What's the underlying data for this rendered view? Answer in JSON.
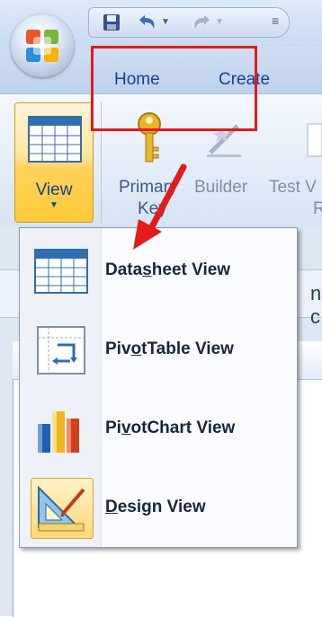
{
  "tabs": [
    {
      "label": "Home"
    },
    {
      "label": "Create"
    }
  ],
  "ribbon": {
    "view_label": "View",
    "primary_key": {
      "line1": "Primary",
      "line2": "Key"
    },
    "builder": "Builder",
    "test": {
      "line1": "Test V",
      "line2": "R"
    }
  },
  "background": {
    "doc_letter": "n c"
  },
  "menu": {
    "items": [
      {
        "before": "Data",
        "mnemonic": "s",
        "after": "heet View"
      },
      {
        "before": "Piv",
        "mnemonic": "o",
        "after": "tTable View"
      },
      {
        "before": "Pi",
        "mnemonic": "v",
        "after": "otChart View"
      },
      {
        "before": "",
        "mnemonic": "D",
        "after": "esign View"
      }
    ]
  },
  "colors": {
    "callout_box": "#e41b1b",
    "annotation_arrow": "#e41b1b",
    "view_button_highlight": "#ffd25a"
  }
}
